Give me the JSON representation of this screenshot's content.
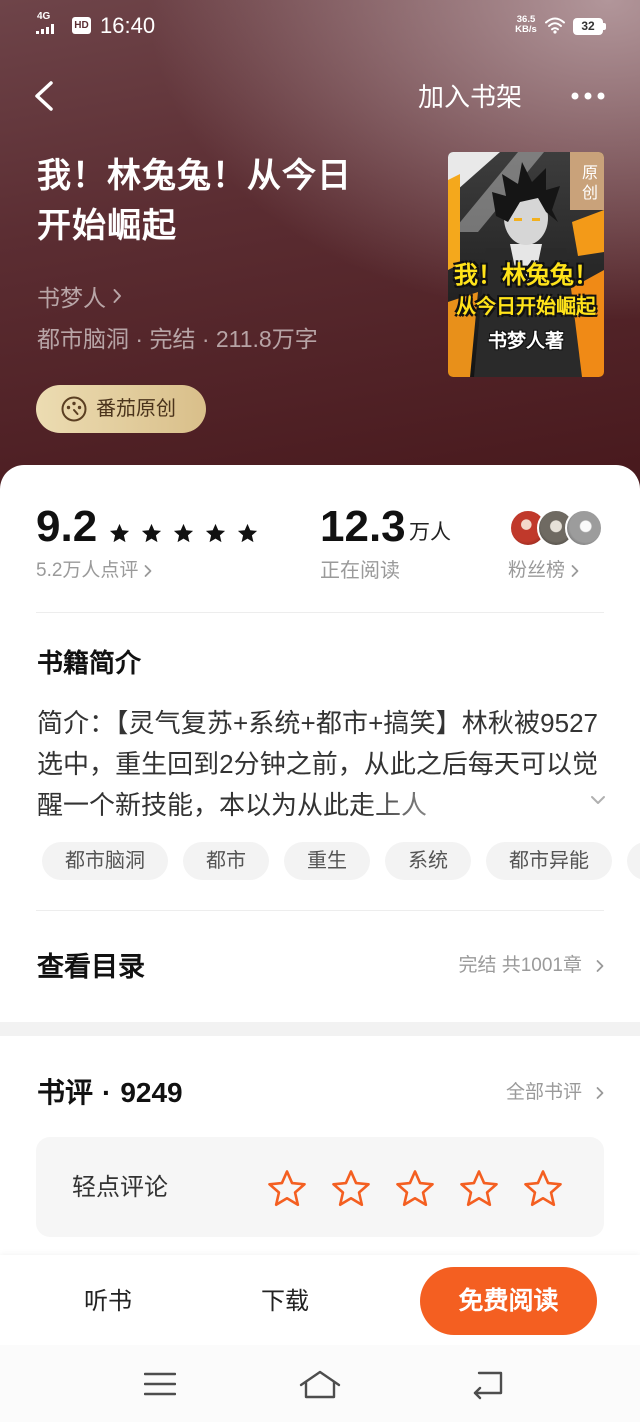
{
  "status_bar": {
    "network": "4G",
    "hd": "HD",
    "time": "16:40",
    "speed_value": "36.5",
    "speed_unit": "KB/s",
    "battery": "32"
  },
  "header": {
    "add_to_shelf": "加入书架"
  },
  "book": {
    "title": "我！林兔兔！从今日开始崛起",
    "author": "书梦人",
    "meta": "都市脑洞 · 完结 · 211.8万字",
    "badge": "番茄原创",
    "cover": {
      "tag": "原创",
      "title_line1": "我！林兔兔！",
      "title_line2": "从今日开始崛起",
      "author_line": "书梦人著"
    }
  },
  "stats": {
    "rating": "9.2",
    "stars_filled": 5,
    "stars_total": 5,
    "rating_count": "5.2万人点评",
    "readers": "12.3",
    "readers_unit": "万人",
    "readers_label": "正在阅读",
    "fans_label": "粉丝榜"
  },
  "intro": {
    "heading": "书籍简介",
    "text": "简介：【灵气复苏+系统+都市+搞笑】林秋被9527选中，重生回到2分钟之前，从此之后每天可以觉醒一个新技能，本以为从此走上人"
  },
  "tags": [
    "都市脑洞",
    "都市",
    "重生",
    "系统",
    "都市异能"
  ],
  "catalog": {
    "label": "查看目录",
    "info": "完结 共1001章"
  },
  "reviews": {
    "label": "书评",
    "separator": "·",
    "count": "9249",
    "all_link": "全部书评",
    "prompt": "轻点评论",
    "user_rating": 0,
    "stars_total": 5
  },
  "bottom_bar": {
    "listen": "听书",
    "download": "下载",
    "read": "免费阅读"
  },
  "icons": {
    "back": "back-icon",
    "more": "more-icon",
    "wifi": "wifi-icon",
    "signal": "signal-icon",
    "badge": "tomato-badge-icon",
    "expand": "chevron-down-icon",
    "menu": "menu-icon",
    "home": "home-icon",
    "system_back": "system-back-icon"
  },
  "colors": {
    "accent": "#f45f21",
    "badge_gold": "#e4cd9c",
    "hero_bg": "#5b2d32"
  }
}
